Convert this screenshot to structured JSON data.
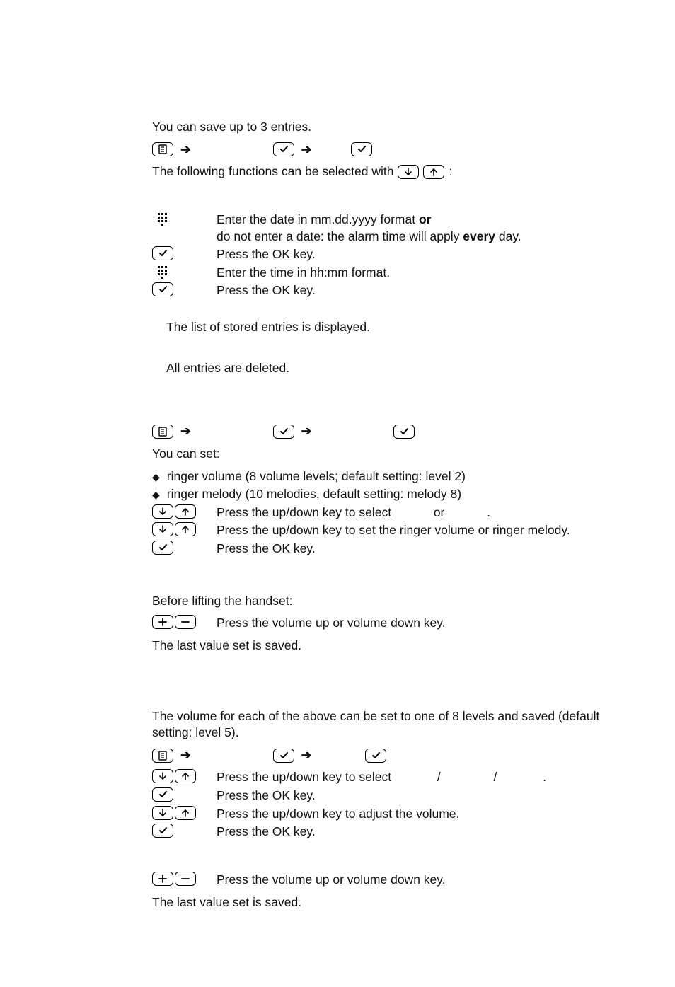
{
  "section1": {
    "intro": "You can save up to 3 entries.",
    "functions_line_a": "The following functions can be selected with ",
    "functions_line_b": ":",
    "step_date_a": "Enter the date in mm.dd.yyyy format ",
    "step_date_or": "or",
    "step_date_b": "do not enter a date: the alarm time will apply ",
    "step_date_every": "every",
    "step_date_c": " day.",
    "step_ok1": "Press the OK key.",
    "step_time": "Enter the time in hh:mm format.",
    "step_ok2": "Press the OK key.",
    "stored": "The list of stored entries is displayed.",
    "deleted": "All entries are deleted."
  },
  "section2": {
    "you_can_set": "You can set:",
    "bullet1": "ringer volume (8 volume levels; default setting: level 2)",
    "bullet2": "ringer melody (10 melodies, default setting: melody 8)",
    "step_select_a": "Press the up/down key to select ",
    "step_select_or": "or",
    "step_select_b": ".",
    "step_set": "Press the up/down key to set the ringer volume or ringer melody.",
    "step_ok": "Press the OK key."
  },
  "section3": {
    "before": "Before lifting the handset:",
    "step_vol": "Press the volume up or volume down key.",
    "saved": "The last value set is saved."
  },
  "section4": {
    "intro": "The volume for each of the above can be set to one of 8 levels and saved (default setting: level 5).",
    "step_select_a": "Press the up/down key to select ",
    "sep": "/",
    "step_select_b": ".",
    "step_ok1": "Press the OK key.",
    "step_adjust": "Press the up/down key to adjust the volume.",
    "step_ok2": "Press the OK key."
  },
  "section5": {
    "step_vol": "Press the volume up or volume down key.",
    "saved": "The last value set is saved."
  }
}
